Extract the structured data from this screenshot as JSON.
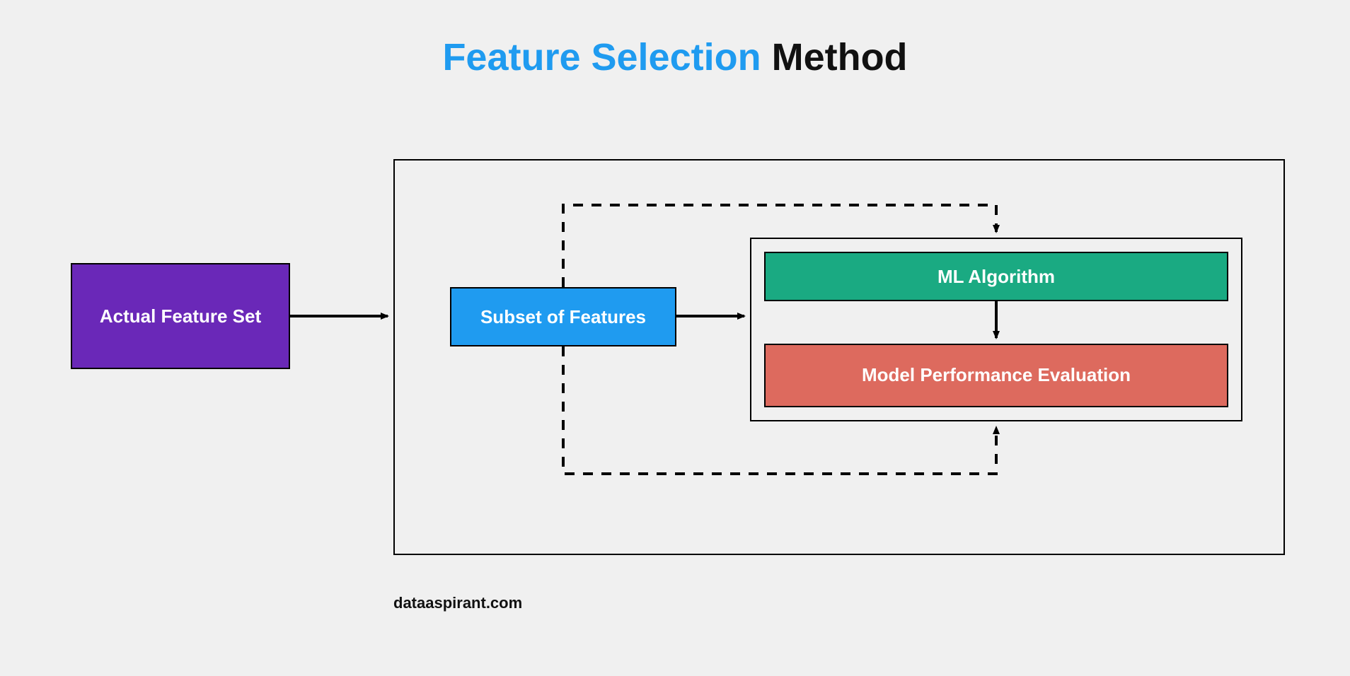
{
  "title": {
    "part1": "Feature Selection",
    "part2": " Method"
  },
  "nodes": {
    "actual_feature_set": "Actual Feature Set",
    "subset_of_features": "Subset of Features",
    "ml_algorithm": "ML Algorithm",
    "model_perf_eval": "Model Performance Evaluation"
  },
  "attribution": "dataaspirant.com",
  "colors": {
    "purple": "#6a28b8",
    "blue": "#1f9bf0",
    "green": "#1aaa82",
    "red": "#dd6a5e",
    "text_dark": "#111111",
    "bg": "#f0f0f0"
  }
}
